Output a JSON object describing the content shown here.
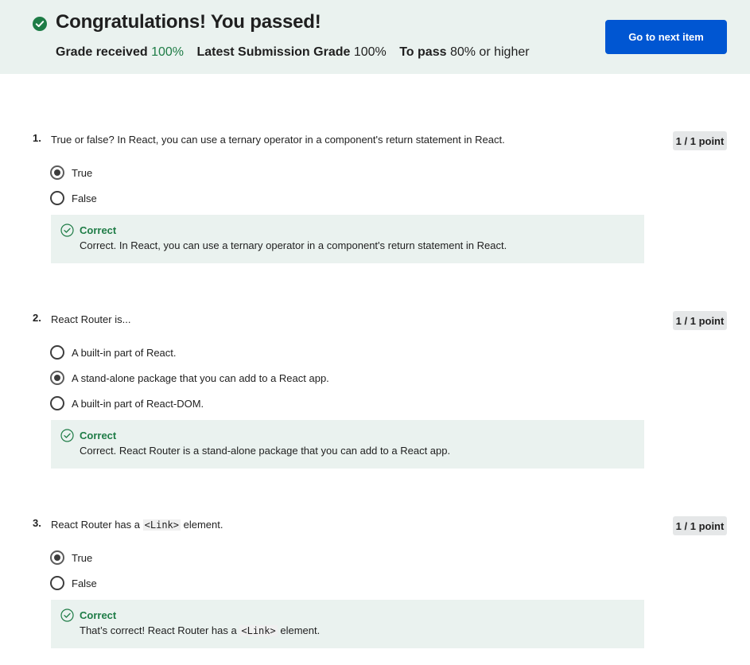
{
  "banner": {
    "title": "Congratulations! You passed!",
    "grade_received_label": "Grade received",
    "grade_received_value": "100%",
    "latest_label": "Latest Submission Grade",
    "latest_value": "100%",
    "to_pass_label": "To pass",
    "to_pass_value": "80% or higher",
    "next_button": "Go to next item",
    "accent_color": "#1e7c46",
    "button_color": "#0056d2"
  },
  "questions": [
    {
      "number": "1.",
      "text": "True or false? In React, you can use a ternary operator in a component's return statement in React.",
      "points": "1 / 1 point",
      "options": [
        {
          "label": "True",
          "selected": true
        },
        {
          "label": "False",
          "selected": false
        }
      ],
      "feedback_title": "Correct",
      "feedback_text": "Correct. In React, you can use a ternary operator in a component's return statement in React."
    },
    {
      "number": "2.",
      "text": "React Router is...",
      "points": "1 / 1 point",
      "options": [
        {
          "label": "A built-in part of React.",
          "selected": false
        },
        {
          "label": "A stand-alone package that you can add to a React app.",
          "selected": true
        },
        {
          "label": "A built-in part of React-DOM.",
          "selected": false
        }
      ],
      "feedback_title": "Correct",
      "feedback_text": "Correct. React Router is a stand-alone package that you can add to a React app."
    },
    {
      "number": "3.",
      "text_before": "React Router has a",
      "text_code": "<Link>",
      "text_after": "element.",
      "points": "1 / 1 point",
      "options": [
        {
          "label": "True",
          "selected": true
        },
        {
          "label": "False",
          "selected": false
        }
      ],
      "feedback_title": "Correct",
      "feedback_before": "That’s correct! React Router has a",
      "feedback_code": "<Link>",
      "feedback_after": "element."
    }
  ]
}
